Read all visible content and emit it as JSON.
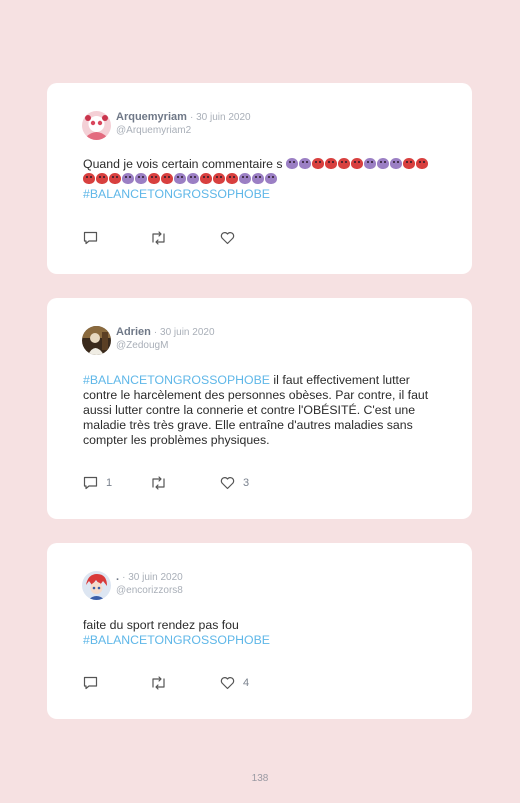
{
  "tweets": [
    {
      "name": "Arquemyriam",
      "date": "· 30 juin 2020",
      "handle": "@Arquemyriam2",
      "text": "Quand je vois certain commentaire s",
      "emojis": [
        "purple",
        "purple",
        "red",
        "red",
        "red",
        "red",
        "purple",
        "purple",
        "purple",
        "red",
        "red",
        "red",
        "red",
        "red",
        "purple",
        "purple",
        "red",
        "red",
        "purple",
        "purple",
        "red",
        "red",
        "red",
        "purple",
        "purple",
        "purple"
      ],
      "hashtag": "#BALANCETONGROSSOPHOBE",
      "text_after": "",
      "replies": "",
      "likes": ""
    },
    {
      "name": "Adrien",
      "date": "· 30 juin 2020",
      "handle": "@ZedougM",
      "hashtag": "#BALANCETONGROSSOPHOBE",
      "text_after": " il faut effectivement lutter contre le harcèlement des personnes obèses. Par contre, il faut aussi lutter contre la connerie et contre l'OBÉSITÉ. C'est une maladie très très grave. Elle entraîne d'autres maladies sans compter les problèmes physiques.",
      "replies": "1",
      "likes": "3"
    },
    {
      "name": ".",
      "date": "· 30 juin 2020",
      "handle": "@encorizzors8",
      "text": "faite du sport rendez pas fou",
      "hashtag": "#BALANCETONGROSSOPHOBE",
      "replies": "",
      "likes": "4"
    }
  ],
  "page_number": "138",
  "colors": {
    "background": "#f6e1e2",
    "hashtag": "#5fb7e8",
    "card": "#ffffff"
  },
  "icons": [
    "reply-icon",
    "retweet-icon",
    "like-icon"
  ]
}
